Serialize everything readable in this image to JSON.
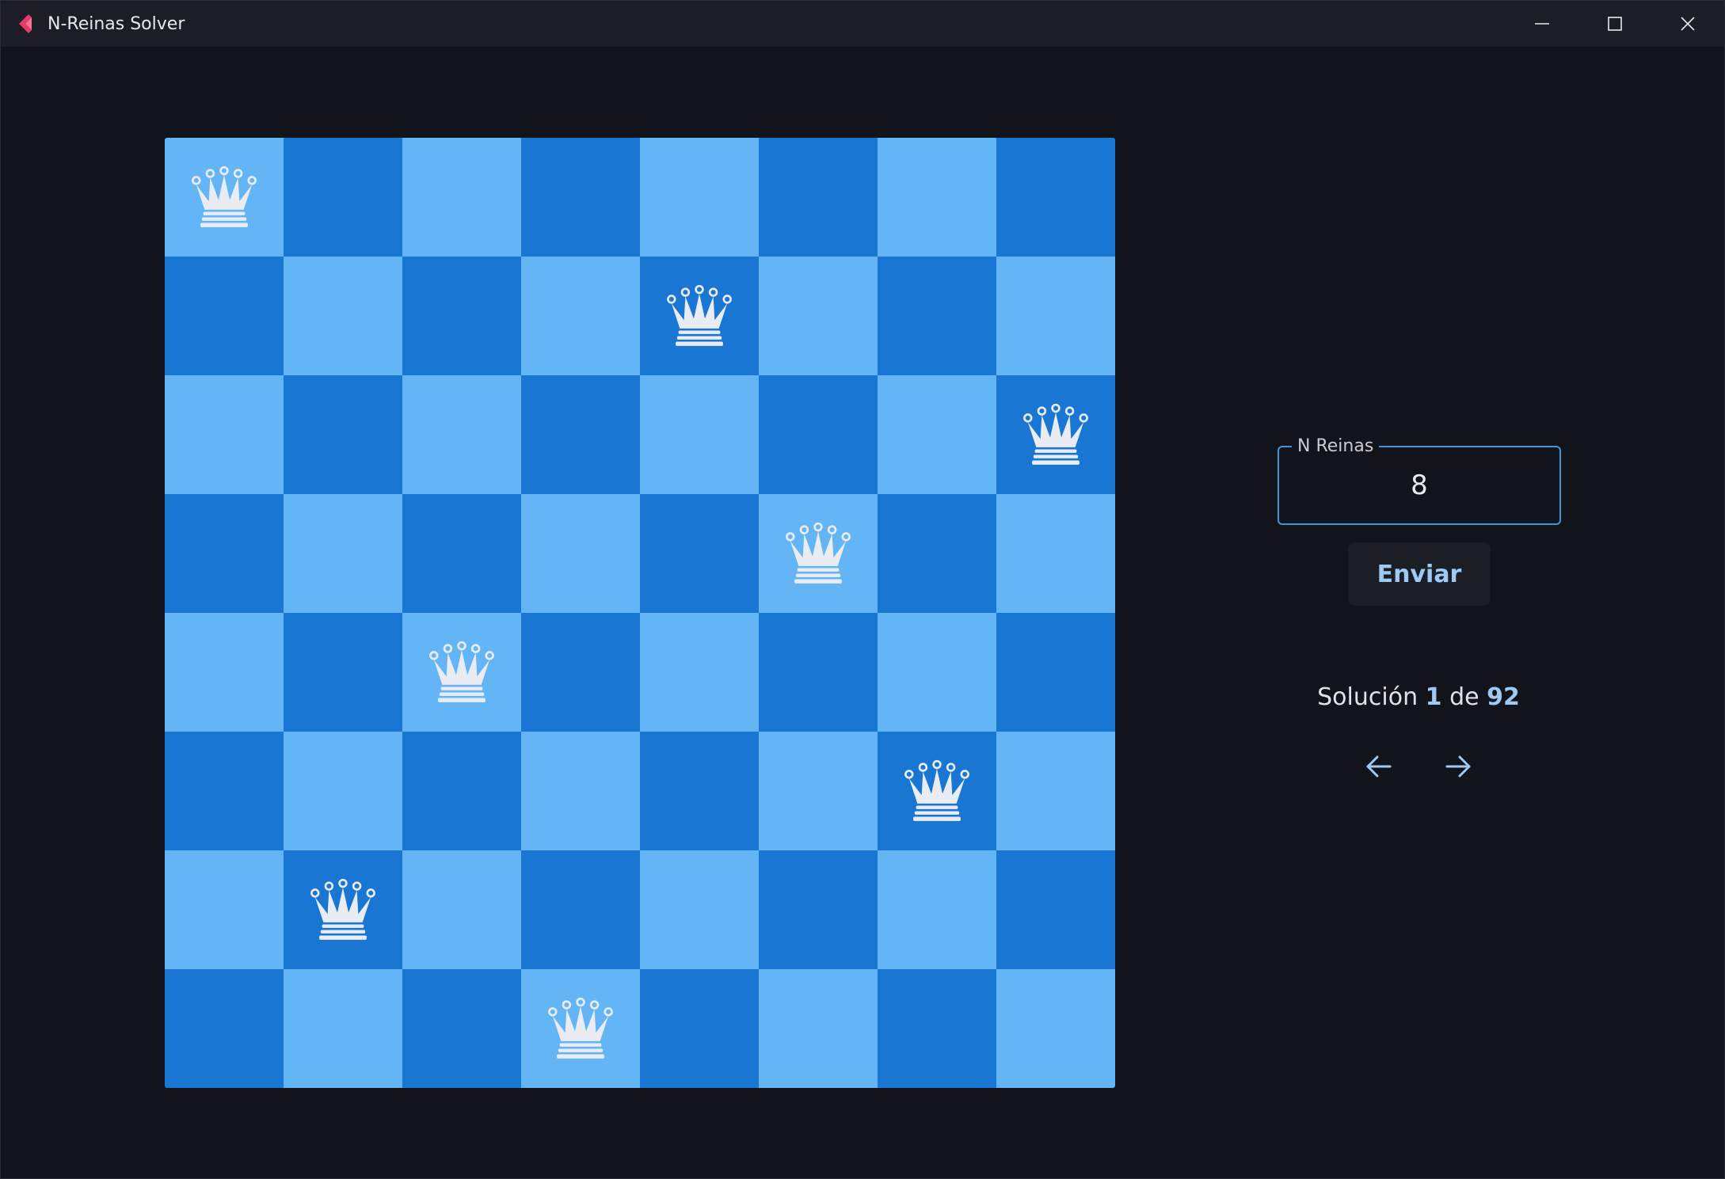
{
  "window": {
    "title": "N-Reinas Solver",
    "controls": [
      "minimize-icon",
      "maximize-icon",
      "close-icon"
    ]
  },
  "board": {
    "size": 8,
    "light_color": "#64b5f6",
    "dark_color": "#1976d2",
    "queen_color": "#e9ecf2",
    "queen_columns_by_row": [
      0,
      4,
      7,
      5,
      2,
      6,
      1,
      3
    ]
  },
  "panel": {
    "field_label": "N Reinas",
    "field_value": "8",
    "send_label": "Enviar",
    "solution_prefix": "Solución",
    "solution_current": "1",
    "solution_sep": "de",
    "solution_total": "92",
    "prev_icon": "arrow-left-icon",
    "next_icon": "arrow-right-icon",
    "accent_color": "#9ec9f5"
  }
}
